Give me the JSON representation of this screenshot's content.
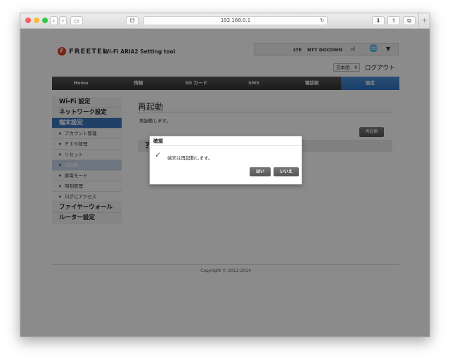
{
  "browser": {
    "url": "192.168.0.1",
    "nav_back_icon": "chevron-left-icon",
    "nav_forward_icon": "chevron-right-icon"
  },
  "header": {
    "logo_letter": "F",
    "brand_name": "FREETEL",
    "tool_name": "Wi-Fi ARIA2 Setting tool",
    "network_type": "LTE",
    "carrier": "NTT DOCOMO",
    "signal_glyph": ".ııl",
    "language": "日本語",
    "logout": "ログアウト"
  },
  "nav": {
    "items": [
      {
        "label": "Home"
      },
      {
        "label": "情報"
      },
      {
        "label": "SD カード"
      },
      {
        "label": "SMS"
      },
      {
        "label": "電話帳"
      },
      {
        "label": "設定"
      }
    ],
    "active_index": 5
  },
  "sidebar": {
    "wifi": "Wi-Fi 設定",
    "network": "ネットワーク設定",
    "device": "端末設定",
    "sub": [
      {
        "label": "アカウント管理"
      },
      {
        "label": "ＰＩＮ管理"
      },
      {
        "label": "リセット"
      },
      {
        "label": "再起動"
      },
      {
        "label": "節電モード"
      },
      {
        "label": "時刻管理"
      },
      {
        "label": "ログにアクセス"
      }
    ],
    "firewall": "ファイヤーウォール",
    "router": "ルーター設定"
  },
  "main": {
    "title": "再起動",
    "description": "再起動します。",
    "reboot_button": "再起動",
    "help_glyph": "?"
  },
  "footer": {
    "copyright": "Copyright © 2013-2014"
  },
  "dialog": {
    "title": "確認",
    "check_glyph": "✓",
    "message": "端末は再起動します。",
    "yes": "はい",
    "no": "いいえ"
  },
  "colors": {
    "accent": "#3d76bd",
    "brand": "#e03a1a"
  }
}
